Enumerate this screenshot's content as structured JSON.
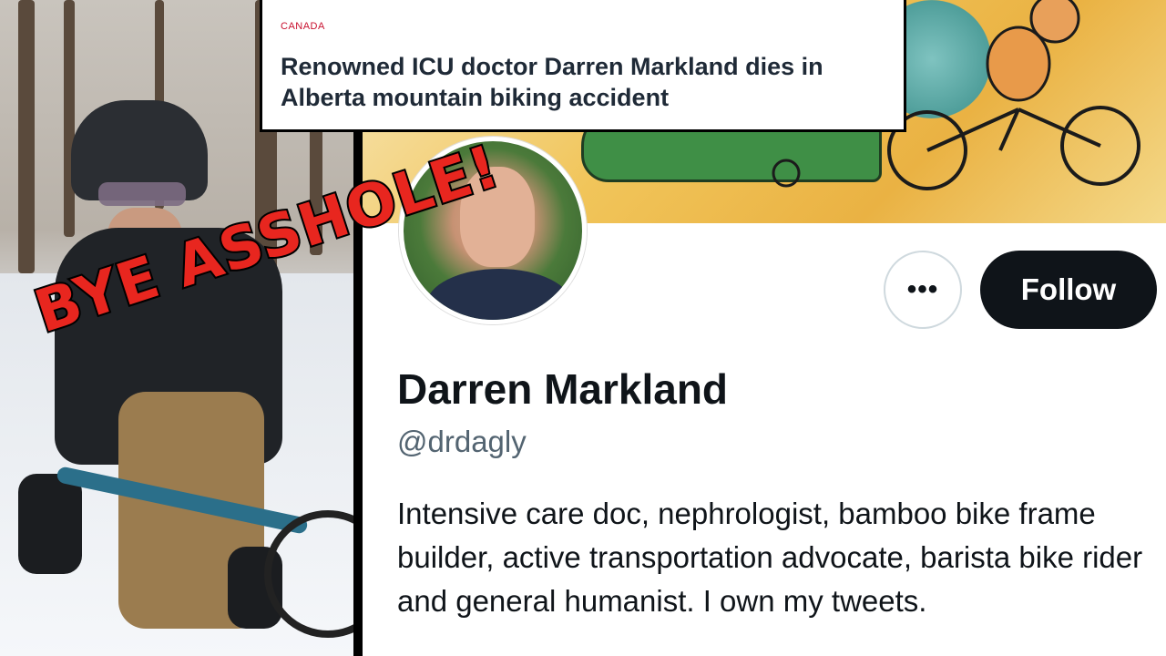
{
  "news": {
    "category": "CANADA",
    "headline": "Renowned ICU doctor Darren Markland dies in Alberta mountain biking accident"
  },
  "profile": {
    "display_name": "Darren Markland",
    "handle": "@drdagly",
    "bio": "Intensive care doc, nephrologist, bamboo bike frame builder, active transportation advocate, barista bike rider and general humanist. I own my tweets.",
    "more_label": "•••",
    "follow_label": "Follow"
  },
  "overlay": {
    "caption": "BYE ASSHOLE!"
  },
  "icons": {
    "more": "more-horizontal-icon"
  },
  "colors": {
    "follow_button_bg": "#0f1419",
    "caption_red": "#e8261f",
    "news_category": "#c8102e"
  }
}
